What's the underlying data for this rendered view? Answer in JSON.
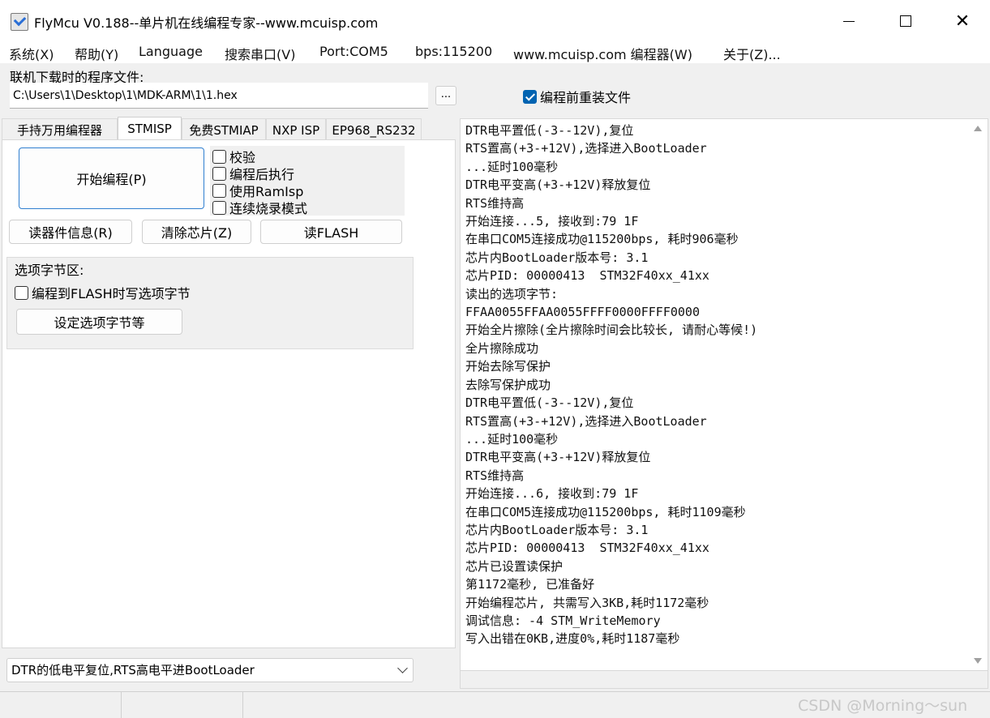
{
  "window": {
    "title": "FlyMcu V0.188--单片机在线编程专家--www.mcuisp.com",
    "close_glyph": "✕"
  },
  "menu": [
    "系统(X)",
    "帮助(Y)",
    "Language",
    "搜索串口(V)",
    "Port:COM5",
    "bps:115200",
    "www.mcuisp.com 编程器(W)",
    "关于(Z)..."
  ],
  "file": {
    "label": "联机下载时的程序文件:",
    "path": "C:\\Users\\1\\Desktop\\1\\MDK-ARM\\1\\1.hex",
    "browse_label": "...",
    "reload_label": "编程前重装文件",
    "reload_checked": true
  },
  "tabs": [
    "手持万用编程器",
    "STMISP",
    "免费STMIAP",
    "NXP ISP",
    "EP968_RS232"
  ],
  "active_tab": "STMISP",
  "stmisp": {
    "start_label": "开始编程(P)",
    "options": [
      {
        "label": "校验",
        "checked": false
      },
      {
        "label": "编程后执行",
        "checked": false
      },
      {
        "label": "使用RamIsp",
        "checked": false
      },
      {
        "label": "连续烧录模式",
        "checked": false
      }
    ],
    "read_info_label": "读器件信息(R)",
    "erase_label": "清除芯片(Z)",
    "read_flash_label": "读FLASH",
    "option_group_title": "选项字节区:",
    "option_write_label": "编程到FLASH时写选项字节",
    "option_write_checked": false,
    "set_option_label": "设定选项字节等",
    "mode_value": "DTR的低电平复位,RTS高电平进BootLoader"
  },
  "log": [
    "DTR电平置低(-3--12V),复位",
    "RTS置高(+3-+12V),选择进入BootLoader",
    "...延时100毫秒",
    "DTR电平变高(+3-+12V)释放复位",
    "RTS维持高",
    "开始连接...5, 接收到:79 1F",
    "在串口COM5连接成功@115200bps, 耗时906毫秒",
    "芯片内BootLoader版本号: 3.1",
    "芯片PID: 00000413  STM32F40xx_41xx",
    "读出的选项字节:",
    "FFAA0055FFAA0055FFFF0000FFFF0000",
    "开始全片擦除(全片擦除时间会比较长, 请耐心等候!)",
    "全片擦除成功",
    "开始去除写保护",
    "去除写保护成功",
    "DTR电平置低(-3--12V),复位",
    "RTS置高(+3-+12V),选择进入BootLoader",
    "...延时100毫秒",
    "DTR电平变高(+3-+12V)释放复位",
    "RTS维持高",
    "开始连接...6, 接收到:79 1F",
    "在串口COM5连接成功@115200bps, 耗时1109毫秒",
    "芯片内BootLoader版本号: 3.1",
    "芯片PID: 00000413  STM32F40xx_41xx",
    "芯片已设置读保护",
    "第1172毫秒, 已准备好",
    "开始编程芯片, 共需写入3KB,耗时1172毫秒",
    "调试信息: -4 STM_WriteMemory",
    "写入出错在0KB,进度0%,耗时1187毫秒"
  ],
  "watermark": "CSDN @Morning～sun",
  "colors": {
    "accent": "#0063b1",
    "focus_border": "#2f7fd0"
  }
}
